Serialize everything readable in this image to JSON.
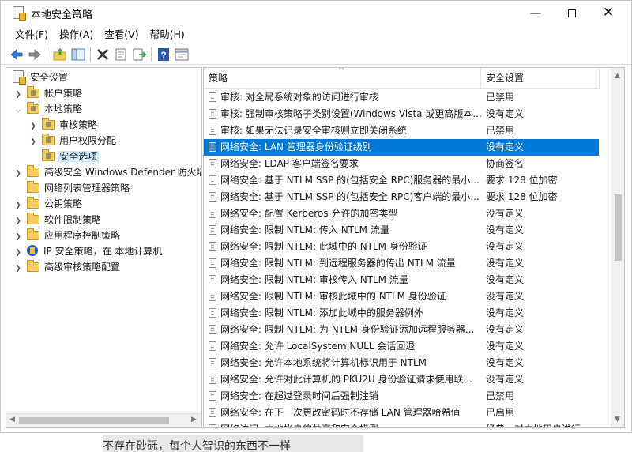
{
  "window": {
    "title": "本地安全策略"
  },
  "menu": [
    "文件(F)",
    "操作(A)",
    "查看(V)",
    "帮助(H)"
  ],
  "toolbar": {
    "icons": [
      "back-arrow-icon",
      "forward-arrow-icon",
      "up-folder-icon",
      "show-tree-icon",
      "delete-icon",
      "properties-icon",
      "export-icon",
      "help-icon",
      "console-icon"
    ]
  },
  "tree": {
    "root": "安全设置",
    "items": [
      {
        "label": "帐户策略",
        "expander": "collapsed",
        "icon": "lock-folder-icon"
      },
      {
        "label": "本地策略",
        "expander": "expanded",
        "icon": "lock-folder-icon"
      },
      {
        "label": "审核策略",
        "expander": "collapsed",
        "icon": "lock-folder-icon"
      },
      {
        "label": "用户权限分配",
        "expander": "collapsed",
        "icon": "lock-folder-icon"
      },
      {
        "label": "安全选项",
        "expander": "none",
        "icon": "lock-folder-icon",
        "selected": true
      },
      {
        "label": "高级安全 Windows Defender 防火墙",
        "expander": "collapsed",
        "icon": "folder-icon"
      },
      {
        "label": "网络列表管理器策略",
        "expander": "none",
        "icon": "folder-icon"
      },
      {
        "label": "公钥策略",
        "expander": "collapsed",
        "icon": "folder-icon"
      },
      {
        "label": "软件限制策略",
        "expander": "collapsed",
        "icon": "folder-icon"
      },
      {
        "label": "应用程序控制策略",
        "expander": "collapsed",
        "icon": "folder-icon"
      },
      {
        "label": "IP 安全策略，在 本地计算机",
        "expander": "collapsed",
        "icon": "ipsec-icon"
      },
      {
        "label": "高级审核策略配置",
        "expander": "collapsed",
        "icon": "folder-icon"
      }
    ]
  },
  "list": {
    "columns": [
      "策略",
      "安全设置"
    ],
    "rows": [
      {
        "policy": "审核: 对全局系统对象的访问进行审核",
        "setting": "已禁用"
      },
      {
        "policy": "审核: 强制审核策略子类别设置(Windows Vista 或更高版本...",
        "setting": "没有定义"
      },
      {
        "policy": "审核: 如果无法记录安全审核则立即关闭系统",
        "setting": "已禁用"
      },
      {
        "policy": "网络安全: LAN 管理器身份验证级别",
        "setting": "没有定义",
        "selected": true
      },
      {
        "policy": "网络安全: LDAP 客户端签名要求",
        "setting": "协商签名"
      },
      {
        "policy": "网络安全: 基于 NTLM SSP 的(包括安全 RPC)服务器的最小...",
        "setting": "要求 128 位加密"
      },
      {
        "policy": "网络安全: 基于 NTLM SSP 的(包括安全 RPC)客户端的最小...",
        "setting": "要求 128 位加密"
      },
      {
        "policy": "网络安全: 配置 Kerberos 允许的加密类型",
        "setting": "没有定义"
      },
      {
        "policy": "网络安全: 限制 NTLM: 传入 NTLM 流量",
        "setting": "没有定义"
      },
      {
        "policy": "网络安全: 限制 NTLM: 此域中的 NTLM 身份验证",
        "setting": "没有定义"
      },
      {
        "policy": "网络安全: 限制 NTLM: 到远程服务器的传出 NTLM 流量",
        "setting": "没有定义"
      },
      {
        "policy": "网络安全: 限制 NTLM: 审核传入 NTLM 流量",
        "setting": "没有定义"
      },
      {
        "policy": "网络安全: 限制 NTLM: 审核此域中的 NTLM 身份验证",
        "setting": "没有定义"
      },
      {
        "policy": "网络安全: 限制 NTLM: 添加此域中的服务器例外",
        "setting": "没有定义"
      },
      {
        "policy": "网络安全: 限制 NTLM: 为 NTLM 身份验证添加远程服务器...",
        "setting": "没有定义"
      },
      {
        "policy": "网络安全: 允许 LocalSystem NULL 会话回退",
        "setting": "没有定义"
      },
      {
        "policy": "网络安全: 允许本地系统将计算机标识用于 NTLM",
        "setting": "没有定义"
      },
      {
        "policy": "网络安全: 允许对此计算机的 PKU2U 身份验证请求使用联...",
        "setting": "没有定义"
      },
      {
        "policy": "网络安全: 在超过登录时间后强制注销",
        "setting": "已禁用"
      },
      {
        "policy": "网络安全: 在下一次更改密码时不存储 LAN 管理器哈希值",
        "setting": "已启用"
      },
      {
        "policy": "网络访问: 本地帐户的共享和安全模型",
        "setting": "经典 - 对本地用户进行..."
      }
    ]
  },
  "caption": "不存在砂砾，每个人智识的东西不一样"
}
